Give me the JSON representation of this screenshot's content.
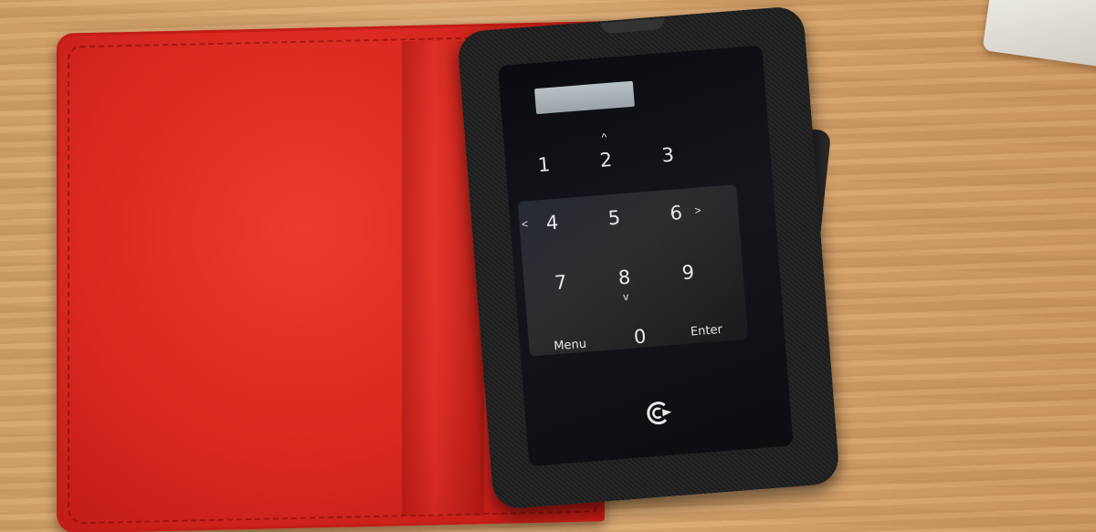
{
  "keypad": {
    "keys": [
      "1",
      "2",
      "3",
      "4",
      "5",
      "6",
      "7",
      "8",
      "9",
      "Menu",
      "0",
      "Enter"
    ],
    "arrows": [
      "^",
      "<",
      ">",
      "v"
    ]
  },
  "colors": {
    "case_red": "#d8281f",
    "holder_black": "#1d1d1d",
    "wood": "#d4a46c"
  },
  "icons": [
    "reload-logo-icon"
  ]
}
